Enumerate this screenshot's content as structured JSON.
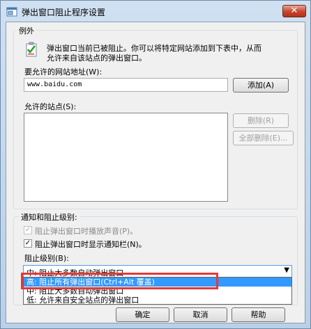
{
  "window": {
    "title": "弹出窗口阻止程序设置",
    "close_label": "✕"
  },
  "exceptions": {
    "legend": "例外",
    "description_line1": "弹出窗口当前已被阻止。你可以将特定网站添加到下表中，从而",
    "description_line2": "允许来自该站点的弹出窗口。",
    "address_label": "要允许的网站地址(W):",
    "address_value": "www.baidu.com",
    "add_button": "添加(A)",
    "allowed_sites_label": "允许的站点(S):",
    "allowed_sites": [],
    "remove_button": "删除(R)",
    "remove_all_button": "全部删除(E)..."
  },
  "notifications": {
    "legend": "通知和阻止级别:",
    "sound": {
      "label": "阻止弹出窗口时播放声音(P)。",
      "checked": true,
      "enabled": false
    },
    "bar": {
      "label": "阻止弹出窗口时显示通知栏(N)。",
      "checked": true,
      "enabled": true
    },
    "level_label": "阻止级别(B):",
    "level_value": "中: 阻止大多数自动弹出窗口",
    "level_options": [
      "高: 阻止所有弹出窗口(Ctrl+Alt 覆盖)",
      "中: 阻止大多数自动弹出窗口",
      "低: 允许来自安全站点的弹出窗口"
    ],
    "highlighted_index": 0
  },
  "footer": {
    "ok_button": "确定",
    "cancel_button": "取消",
    "help_button": "帮助"
  },
  "icons": {
    "app": "popup-blocker-icon",
    "info": "checklist-icon",
    "warning": "warning-icon"
  },
  "colors": {
    "accent": "#3399ff",
    "highlight_box": "#e53838",
    "titlebar": "#cfe0f1"
  }
}
